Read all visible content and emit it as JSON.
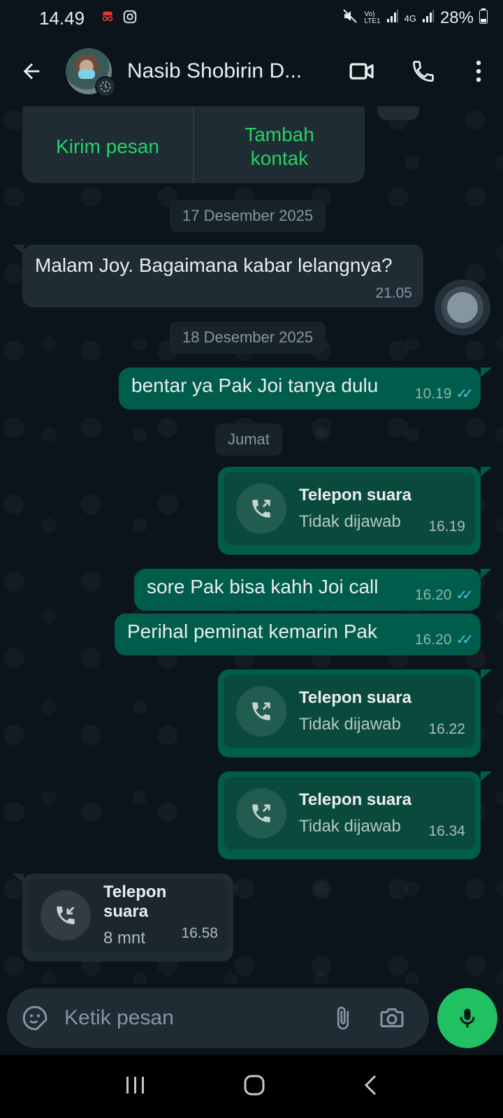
{
  "status_bar": {
    "time": "14.49",
    "network_vol": "Vo)",
    "network_lte": "LTE1",
    "network_type": "4G",
    "battery": "28%"
  },
  "header": {
    "contact_name": "Nasib Shobirin D...",
    "icons": [
      "back-arrow-icon",
      "video-call-icon",
      "phone-icon",
      "more-vertical-icon"
    ]
  },
  "contact_card": {
    "send_message": "Kirim pesan",
    "add_contact_line1": "Tambah",
    "add_contact_line2": "kontak"
  },
  "messages": [
    {
      "type": "date",
      "text": "17 Desember 2025"
    },
    {
      "type": "in",
      "text": "Malam Joy. Bagaimana kabar lelangnya?",
      "time": "21.05"
    },
    {
      "type": "date",
      "text": "18 Desember 2025"
    },
    {
      "type": "out",
      "text": "bentar ya Pak Joi tanya dulu",
      "time": "10.19",
      "read": true
    },
    {
      "type": "date",
      "text": "Jumat"
    },
    {
      "type": "call_out",
      "title": "Telepon suara",
      "subtitle": "Tidak dijawab",
      "time": "16.19"
    },
    {
      "type": "out",
      "text": "sore Pak bisa kahh Joi call",
      "time": "16.20",
      "read": true
    },
    {
      "type": "out",
      "text": "Perihal peminat kemarin Pak",
      "time": "16.20",
      "read": true
    },
    {
      "type": "call_out",
      "title": "Telepon suara",
      "subtitle": "Tidak dijawab",
      "time": "16.22"
    },
    {
      "type": "call_out",
      "title": "Telepon suara",
      "subtitle": "Tidak dijawab",
      "time": "16.34"
    },
    {
      "type": "call_in",
      "title": "Telepon suara",
      "subtitle": "8 mnt",
      "time": "16.58"
    }
  ],
  "composer": {
    "placeholder": "Ketik pesan"
  },
  "colors": {
    "accent": "#25d366",
    "outgoing_bubble": "#005c4b",
    "incoming_bubble": "#1f2c34",
    "read_ticks": "#53bdeb",
    "background": "#0b141a"
  }
}
